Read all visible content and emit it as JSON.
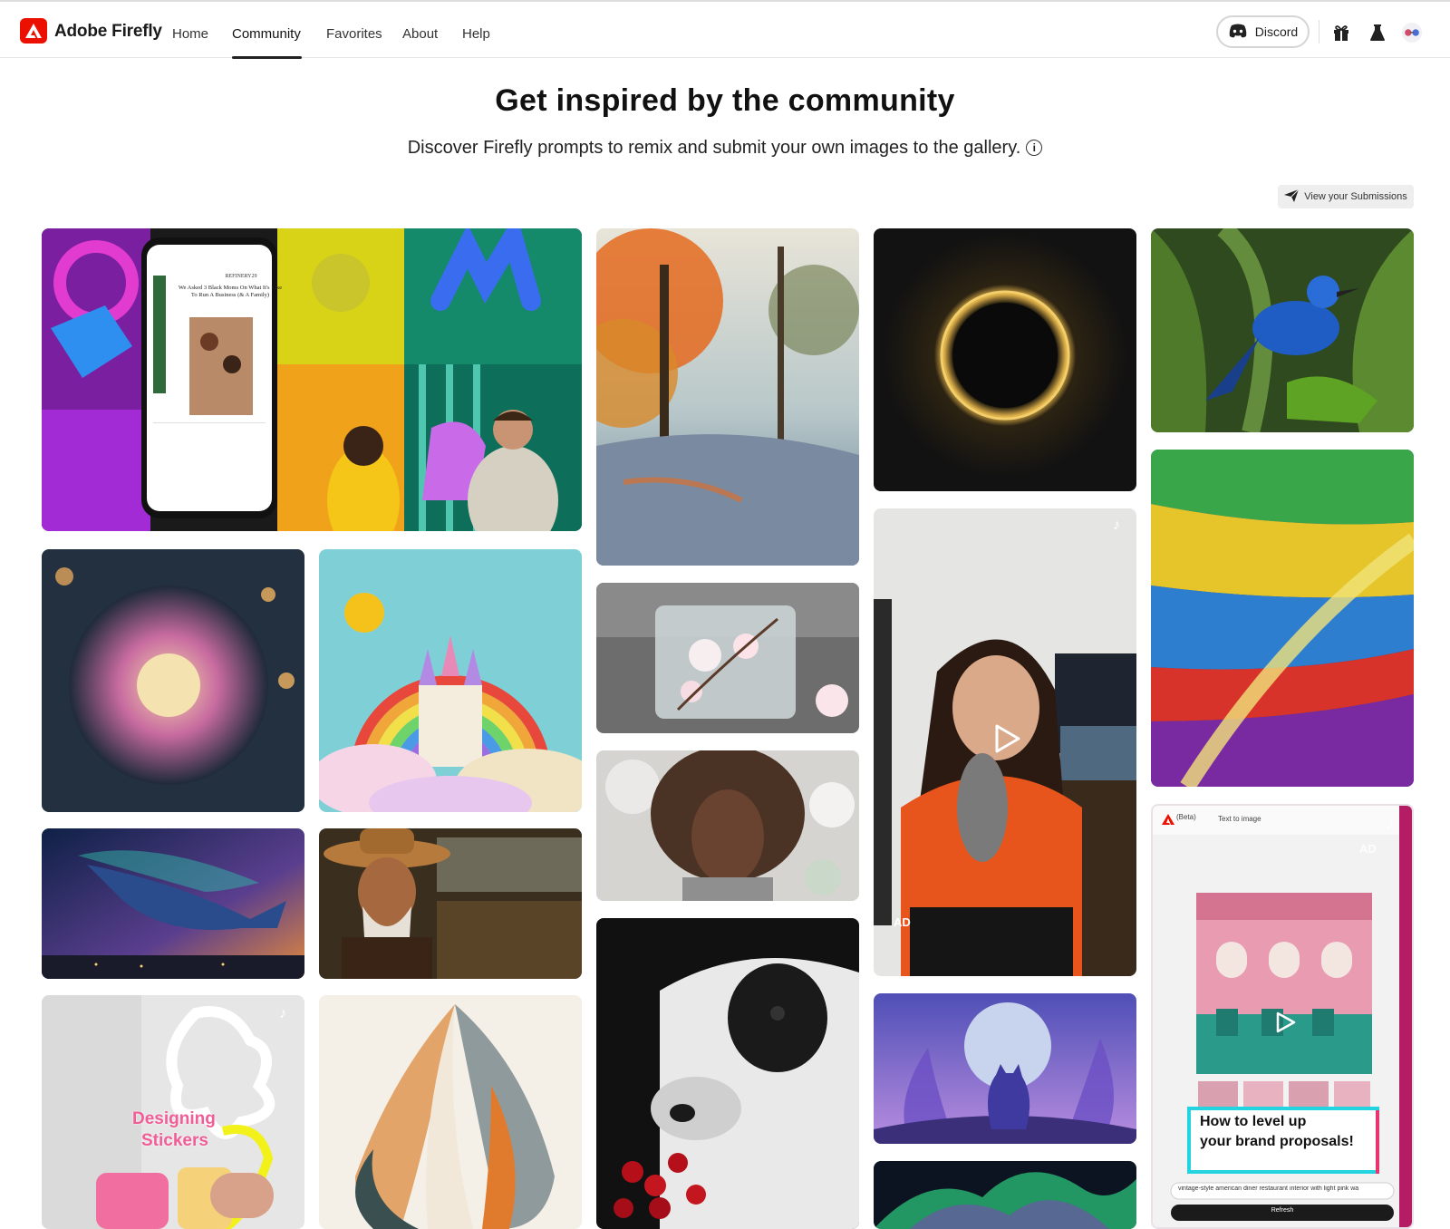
{
  "app": {
    "name": "Adobe Firefly",
    "nav": [
      {
        "label": "Home"
      },
      {
        "label": "Community"
      },
      {
        "label": "Favorites"
      },
      {
        "label": "About"
      },
      {
        "label": "Help"
      }
    ],
    "active_nav": "Community",
    "discord_label": "Discord"
  },
  "hero": {
    "title": "Get inspired by the community",
    "subtitle": "Discover Firefly prompts to remix and submit your own images to the gallery.",
    "submissions_label": "View your Submissions"
  },
  "tiles": {
    "ad_label": "AD",
    "phone_ad": {
      "header_beta": "(Beta)",
      "header_text": "Text to image",
      "caption_line1": "How to level up",
      "caption_line2": "your brand proposals!",
      "prompt": "vintage-style american diner restaurant interior with light pink wa",
      "refresh_label": "Refresh"
    },
    "phone_feature": {
      "brand": "REFINERY29",
      "headline": "We Asked 3 Black Moms On What It's Like To Run A Business (& A Family)"
    },
    "sticker_ad": {
      "line1": "Designing",
      "line2": "Stickers"
    }
  },
  "colors": {
    "brand_red": "#eb1000",
    "nav_active": "#222222"
  },
  "icons": [
    "adobe-logo-icon",
    "discord-icon",
    "gift-icon",
    "beaker-icon",
    "avatar-icon",
    "info-icon",
    "send-icon",
    "play-icon",
    "tiktok-icon"
  ]
}
